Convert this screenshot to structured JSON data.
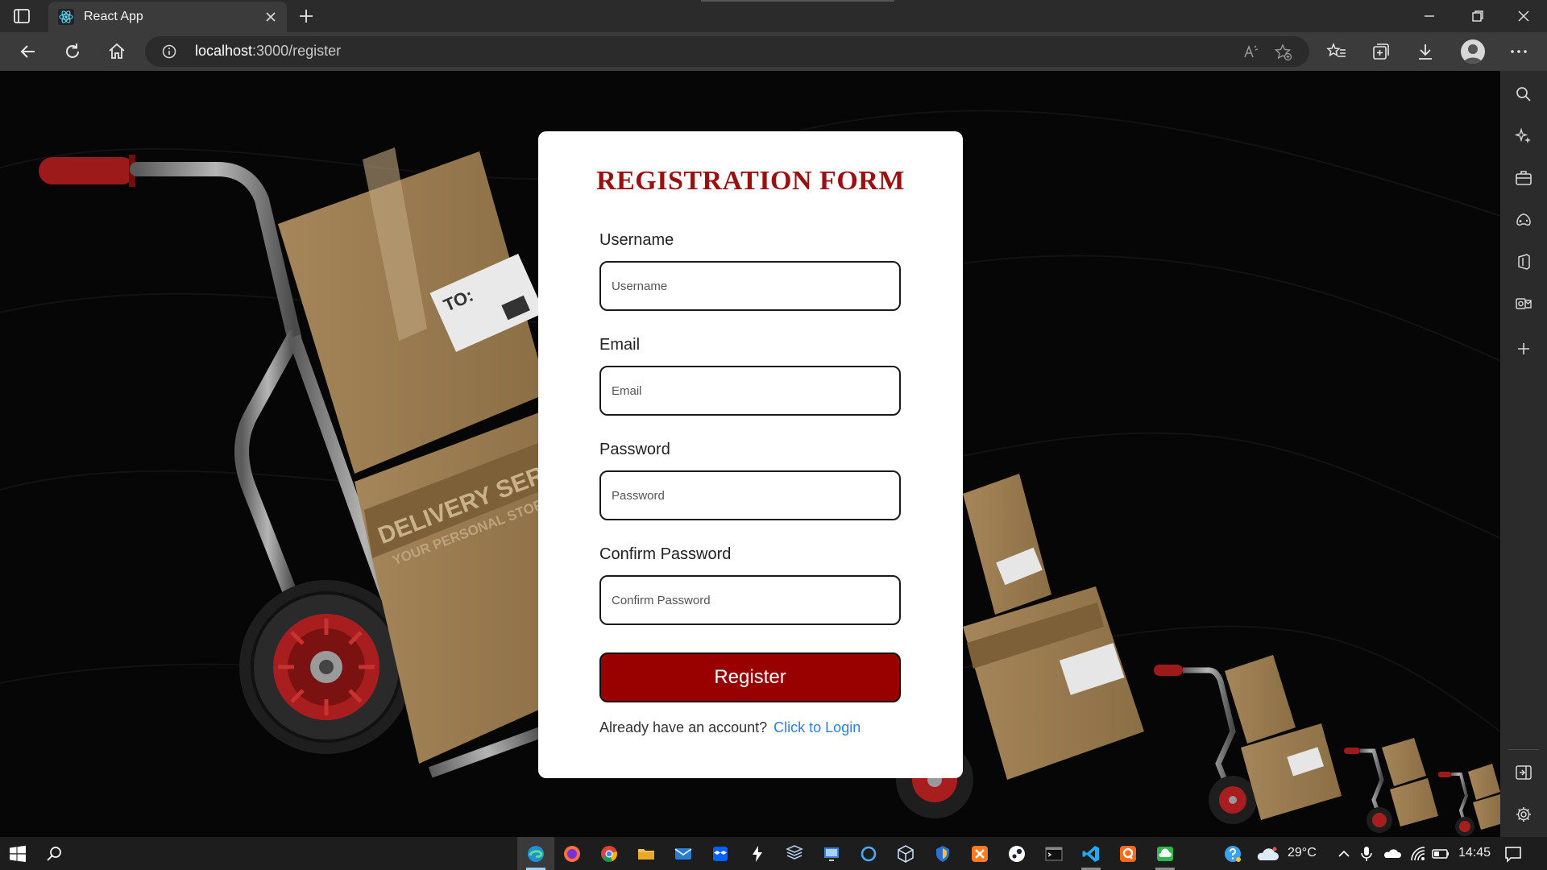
{
  "browser": {
    "tab_title": "React App",
    "url_host": "localhost",
    "url_rest": ":3000/register"
  },
  "form": {
    "title": "REGISTRATION FORM",
    "fields": [
      {
        "label": "Username",
        "placeholder": "Username"
      },
      {
        "label": "Email",
        "placeholder": "Email"
      },
      {
        "label": "Password",
        "placeholder": "Password"
      },
      {
        "label": "Confirm Password",
        "placeholder": "Confirm Password"
      }
    ],
    "submit_label": "Register",
    "login_prompt": "Already have an account?",
    "login_link": "Click to Login"
  },
  "background": {
    "box_label_main": "DELIVERY SERVICE",
    "box_label_sub": "YOUR PERSONAL STORAGE",
    "box_address": "TO:"
  },
  "taskbar": {
    "temperature": "29°C",
    "time": "14:45"
  },
  "colors": {
    "brand_red": "#990000",
    "title_red": "#9a0f0f",
    "link_blue": "#2f7fd6",
    "chrome_dark": "#2b2b2b",
    "chrome_mid": "#3b3b3b"
  }
}
